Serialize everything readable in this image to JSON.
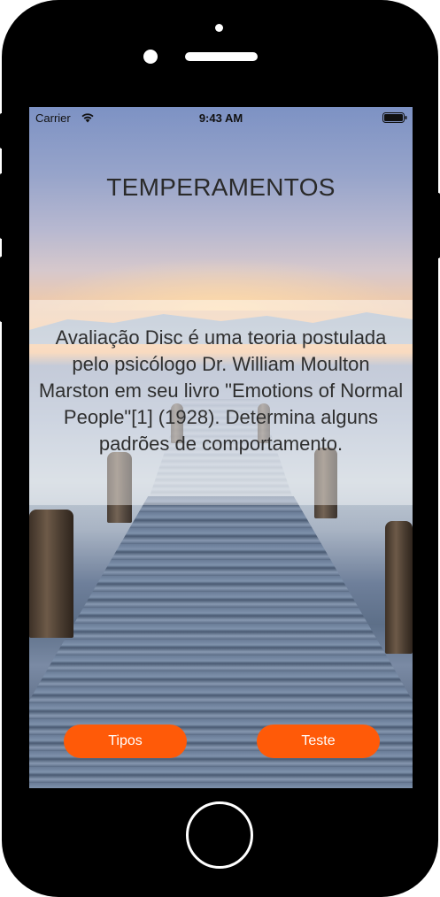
{
  "status_bar": {
    "carrier": "Carrier",
    "time": "9:43 AM",
    "wifi_icon": "wifi-icon",
    "battery_icon": "battery-icon"
  },
  "screen": {
    "title": "TEMPERAMENTOS",
    "description": "Avaliação Disc é uma teoria postulada pelo psicólogo Dr. William Moulton Marston em seu livro \"Emotions of Normal People\"[1] (1928). Determina alguns padrões de comportamento.",
    "buttons": {
      "tipos_label": "Tipos",
      "teste_label": "Teste"
    }
  },
  "colors": {
    "button_background": "#ff5a08",
    "button_text": "#ffffff",
    "device_frame": "#000000"
  }
}
